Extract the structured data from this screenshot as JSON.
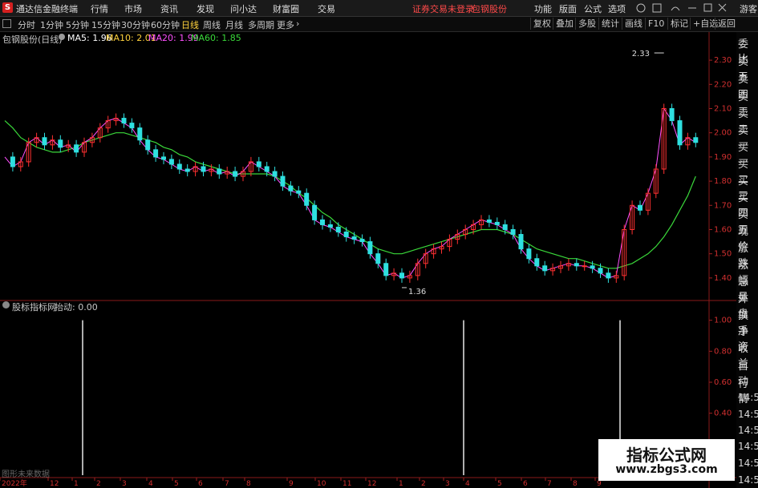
{
  "app": {
    "title": "通达信金融终端"
  },
  "menu": [
    "行情",
    "市场",
    "资讯",
    "发现",
    "问小达",
    "财富圈",
    "交易"
  ],
  "notice": {
    "trade": "证券交易未登录",
    "stock": "包钢股份"
  },
  "menu_right": [
    "功能",
    "版面",
    "公式",
    "选项"
  ],
  "guest": "游客",
  "periods": [
    "分时",
    "1分钟",
    "5分钟",
    "15分钟",
    "30分钟",
    "60分钟",
    "日线",
    "周线",
    "月线",
    "多周期",
    "更多"
  ],
  "active_period": "日线",
  "toolbar_right": [
    "复权",
    "叠加",
    "多股",
    "统计",
    "画线",
    "F10",
    "标记",
    "+自选",
    "返回"
  ],
  "legend": {
    "name": "包钢股份(日线)",
    "ma": [
      {
        "label": "MA5: 1.96",
        "color": "#ffffff"
      },
      {
        "label": "MA10: 2.01",
        "color": "#ffd23c"
      },
      {
        "label": "MA20: 1.99",
        "color": "#ff50ff"
      },
      {
        "label": "MA60: 1.85",
        "color": "#3ad83a"
      }
    ]
  },
  "indicator": {
    "name": "股标指标网",
    "signal": "抬动: 0.00",
    "nodata": "图形未来数据"
  },
  "sidebar": [
    "委比",
    "卖五",
    "卖四",
    "卖三",
    "卖二",
    "卖一",
    "买一",
    "买二",
    "买三",
    "买四",
    "买五",
    "现价",
    "涨跌",
    "涨幅",
    "总量",
    "外盘",
    "换手",
    "净资",
    "收益",
    "自动",
    "行情",
    "14:50",
    "14:50",
    "14:50",
    "14:50",
    "14:50",
    "14:50",
    "14:50"
  ],
  "chart_data": [
    {
      "type": "candlestick",
      "title": "包钢股份(日线)",
      "y_ticks": [
        "2.30",
        "2.20",
        "2.10",
        "2.00",
        "1.90",
        "1.80",
        "1.70",
        "1.60",
        "1.50",
        "1.40"
      ],
      "ylim": [
        1.34,
        2.35
      ],
      "annotations": [
        {
          "label": "2.33",
          "value": 2.33
        },
        {
          "label": "1.36",
          "value": 1.36
        }
      ],
      "x": [
        0,
        10,
        20,
        30,
        40,
        50,
        60,
        70,
        80,
        90,
        100,
        110,
        120,
        130,
        140,
        150,
        160,
        170,
        180,
        190,
        200,
        210,
        220,
        230,
        240,
        250,
        260,
        270,
        280,
        290,
        300,
        310,
        320,
        330,
        340,
        350,
        360,
        370,
        380,
        390,
        400,
        410,
        420,
        430,
        440,
        450,
        460,
        470,
        480,
        490,
        500,
        510,
        520,
        530,
        540,
        550,
        560,
        570,
        580,
        590,
        600,
        610,
        620,
        630,
        640,
        650,
        660,
        670,
        680,
        690,
        700,
        710,
        720,
        730,
        740,
        750,
        760,
        770,
        780,
        790,
        800,
        810,
        820,
        830,
        840,
        850,
        860,
        870
      ],
      "close": [
        1.9,
        1.86,
        1.88,
        1.96,
        1.98,
        1.95,
        1.97,
        1.94,
        1.95,
        1.92,
        1.96,
        1.98,
        2.02,
        2.05,
        2.06,
        2.04,
        2.02,
        1.97,
        1.93,
        1.9,
        1.89,
        1.87,
        1.85,
        1.84,
        1.86,
        1.84,
        1.85,
        1.83,
        1.84,
        1.82,
        1.84,
        1.88,
        1.86,
        1.84,
        1.82,
        1.78,
        1.76,
        1.75,
        1.7,
        1.64,
        1.62,
        1.61,
        1.59,
        1.57,
        1.56,
        1.55,
        1.5,
        1.46,
        1.41,
        1.42,
        1.4,
        1.41,
        1.46,
        1.5,
        1.52,
        1.53,
        1.56,
        1.58,
        1.6,
        1.62,
        1.64,
        1.63,
        1.62,
        1.6,
        1.58,
        1.52,
        1.48,
        1.45,
        1.43,
        1.44,
        1.45,
        1.46,
        1.45,
        1.45,
        1.44,
        1.42,
        1.4,
        1.41,
        1.6,
        1.7,
        1.68,
        1.75,
        1.85,
        2.1,
        2.05,
        1.95,
        1.98,
        1.96
      ],
      "ma60": [
        2.05,
        2.02,
        1.98,
        1.96,
        1.94,
        1.93,
        1.92,
        1.92,
        1.93,
        1.94,
        1.96,
        1.97,
        1.98,
        1.99,
        2.0,
        2.0,
        1.99,
        1.98,
        1.97,
        1.96,
        1.94,
        1.93,
        1.91,
        1.9,
        1.88,
        1.87,
        1.86,
        1.85,
        1.84,
        1.83,
        1.83,
        1.83,
        1.83,
        1.83,
        1.82,
        1.8,
        1.78,
        1.75,
        1.73,
        1.7,
        1.67,
        1.65,
        1.62,
        1.6,
        1.58,
        1.56,
        1.54,
        1.52,
        1.51,
        1.5,
        1.5,
        1.51,
        1.52,
        1.53,
        1.54,
        1.55,
        1.56,
        1.57,
        1.58,
        1.59,
        1.6,
        1.6,
        1.6,
        1.59,
        1.58,
        1.56,
        1.54,
        1.52,
        1.51,
        1.5,
        1.49,
        1.48,
        1.48,
        1.47,
        1.46,
        1.45,
        1.44,
        1.44,
        1.45,
        1.46,
        1.48,
        1.5,
        1.53,
        1.57,
        1.62,
        1.68,
        1.74,
        1.82
      ]
    },
    {
      "type": "bar",
      "title": "股标指标网",
      "y_ticks": [
        "1.00",
        "0.80",
        "0.60",
        "0.40",
        "0.20"
      ],
      "ylim": [
        0,
        1.05
      ],
      "spikes": [
        {
          "x": 103,
          "value": 1.0
        },
        {
          "x": 578,
          "value": 1.0
        },
        {
          "x": 773,
          "value": 1.0
        }
      ]
    }
  ],
  "date_axis": [
    "2022年",
    "12",
    "1",
    "2",
    "3",
    "4",
    "5",
    "6",
    "7",
    "8",
    "9",
    "10",
    "11",
    "12",
    "1",
    "2",
    "3",
    "4",
    "5",
    "6",
    "7",
    "8",
    "9"
  ]
}
